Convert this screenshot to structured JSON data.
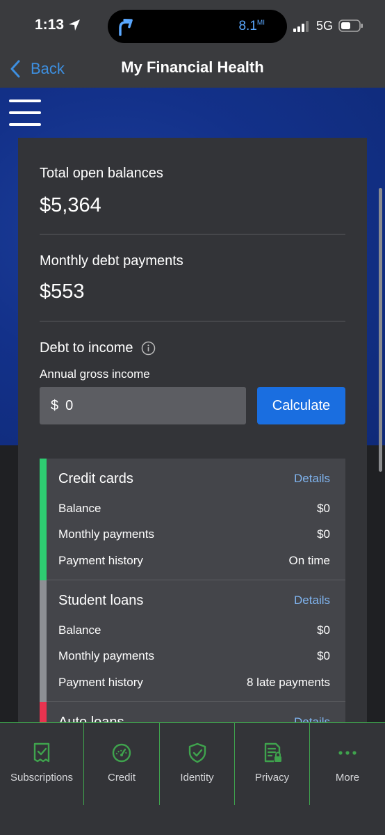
{
  "status": {
    "time": "1:13",
    "island_value": "8.1",
    "island_unit": "MI",
    "network": "5G"
  },
  "nav": {
    "back_label": "Back",
    "title": "My Financial Health"
  },
  "summary": {
    "total_label": "Total open balances",
    "total_value": "$5,364",
    "monthly_label": "Monthly debt payments",
    "monthly_value": "$553",
    "dti_label": "Debt to income",
    "income_label": "Annual gross income",
    "income_prefix": "$",
    "income_value": "0",
    "calculate_label": "Calculate"
  },
  "debts": [
    {
      "title": "Credit cards",
      "details": "Details",
      "color": "#2ecc71",
      "rows": [
        {
          "label": "Balance",
          "value": "$0"
        },
        {
          "label": "Monthly payments",
          "value": "$0"
        },
        {
          "label": "Payment history",
          "value": "On time"
        }
      ]
    },
    {
      "title": "Student loans",
      "details": "Details",
      "color": "#8d8f94",
      "rows": [
        {
          "label": "Balance",
          "value": "$0"
        },
        {
          "label": "Monthly payments",
          "value": "$0"
        },
        {
          "label": "Payment history",
          "value": "8 late payments"
        }
      ]
    },
    {
      "title": "Auto loans",
      "details": "Details",
      "color": "#e8334f",
      "rows": []
    }
  ],
  "tabs": [
    {
      "label": "Subscriptions",
      "icon": "receipt-check-icon"
    },
    {
      "label": "Credit",
      "icon": "gauge-icon"
    },
    {
      "label": "Identity",
      "icon": "shield-check-icon"
    },
    {
      "label": "Privacy",
      "icon": "document-lock-icon"
    },
    {
      "label": "More",
      "icon": "more-dots-icon"
    }
  ],
  "colors": {
    "accent_green": "#3fa34d",
    "link_blue": "#3d8fe0",
    "button_blue": "#1a6ee0"
  }
}
